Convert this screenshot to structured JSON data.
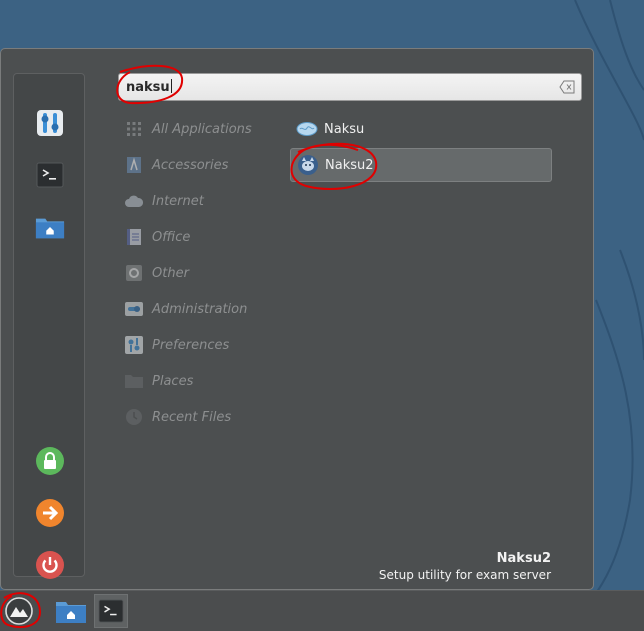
{
  "search": {
    "value": "naksu"
  },
  "favorites": [
    {
      "name": "settings-icon"
    },
    {
      "name": "terminal-icon"
    },
    {
      "name": "home-folder-icon"
    }
  ],
  "session": [
    {
      "name": "lock-screen-icon",
      "color": "#5cb85c"
    },
    {
      "name": "logout-icon",
      "color": "#f0852d"
    },
    {
      "name": "power-icon",
      "color": "#d9534f"
    }
  ],
  "categories": [
    {
      "label": "All Applications",
      "icon": "grid-icon"
    },
    {
      "label": "Accessories",
      "icon": "accessories-icon"
    },
    {
      "label": "Internet",
      "icon": "cloud-icon"
    },
    {
      "label": "Office",
      "icon": "document-icon"
    },
    {
      "label": "Other",
      "icon": "gear-icon"
    },
    {
      "label": "Administration",
      "icon": "toggle-icon"
    },
    {
      "label": "Preferences",
      "icon": "preferences-icon"
    },
    {
      "label": "Places",
      "icon": "folder-icon"
    },
    {
      "label": "Recent Files",
      "icon": "recent-icon"
    }
  ],
  "results": [
    {
      "label": "Naksu",
      "icon": "naksu-brain-icon"
    },
    {
      "label": "Naksu2",
      "icon": "naksu2-cat-icon"
    }
  ],
  "description": {
    "title": "Naksu2",
    "subtitle": "Setup utility for exam server"
  },
  "colors": {
    "annotation": "#e00000",
    "desktop": "#3c6283",
    "menu_bg": "#4c4f50"
  }
}
